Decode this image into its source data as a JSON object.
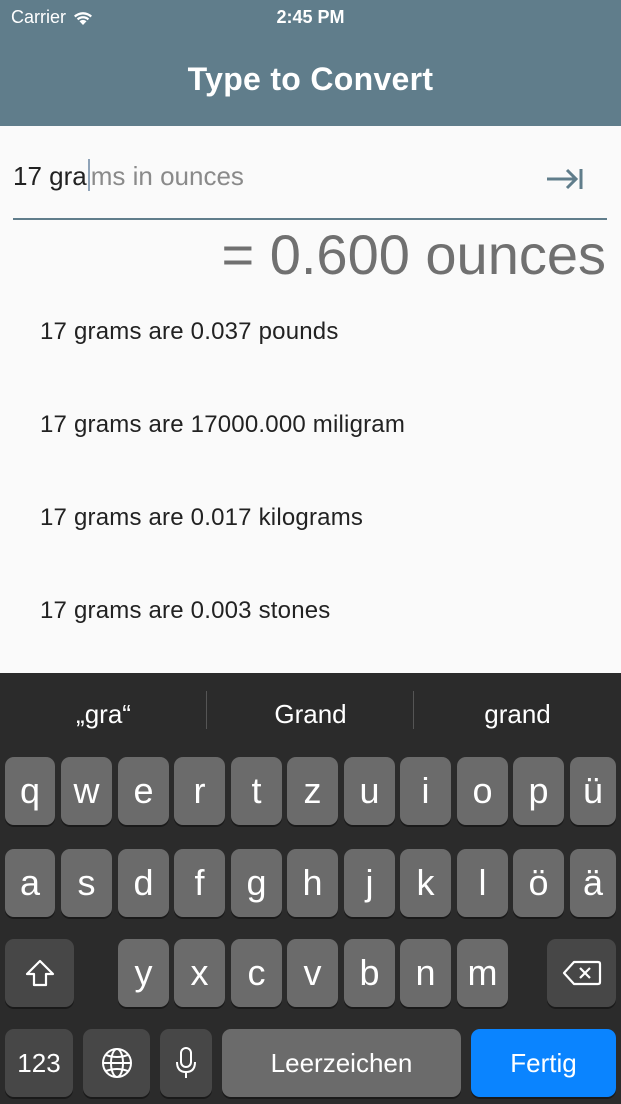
{
  "status_bar": {
    "carrier": "Carrier",
    "time": "2:45 PM"
  },
  "header": {
    "title": "Type to Convert"
  },
  "input": {
    "typed": "17 gra",
    "suggestion": "ms in ounces"
  },
  "result": "= 0.600 ounces",
  "conversions": [
    "17 grams are 0.037 pounds",
    "17 grams are 17000.000 miligram",
    "17 grams are 0.017 kilograms",
    "17 grams are 0.003 stones"
  ],
  "keyboard": {
    "suggestions": [
      "„gra“",
      "Grand",
      "grand"
    ],
    "row1": [
      "q",
      "w",
      "e",
      "r",
      "t",
      "z",
      "u",
      "i",
      "o",
      "p",
      "ü"
    ],
    "row2": [
      "a",
      "s",
      "d",
      "f",
      "g",
      "h",
      "j",
      "k",
      "l",
      "ö",
      "ä"
    ],
    "row3": [
      "y",
      "x",
      "c",
      "v",
      "b",
      "n",
      "m"
    ],
    "numbers_key": "123",
    "space_label": "Leerzeichen",
    "return_label": "Fertig"
  },
  "icons": [
    "wifi-icon",
    "tab-arrow-icon",
    "shift-icon",
    "backspace-icon",
    "globe-icon",
    "microphone-icon"
  ]
}
